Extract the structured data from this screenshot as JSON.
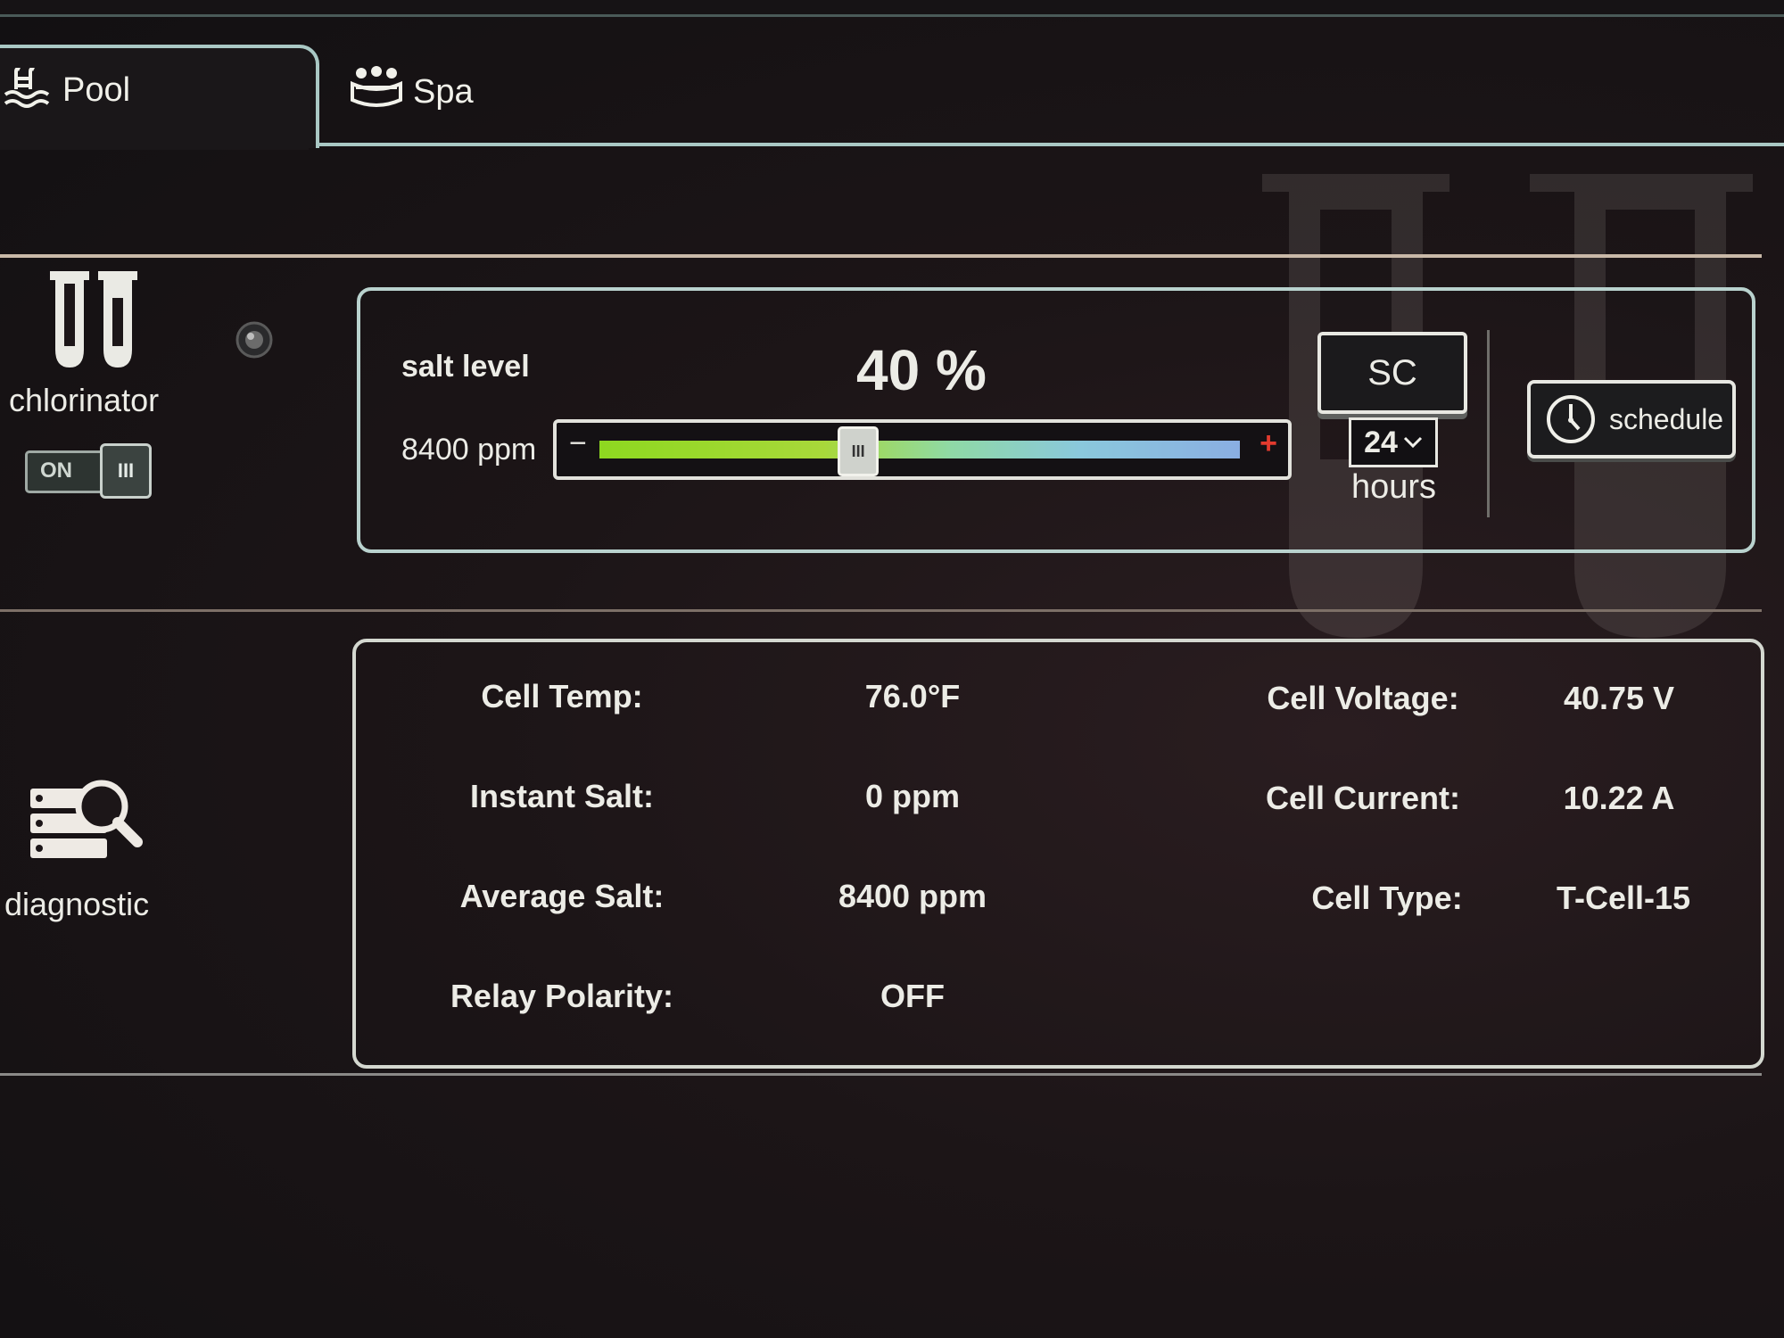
{
  "tabs": [
    {
      "label": "Pool",
      "icon": "swimming-pool-icon",
      "active": true
    },
    {
      "label": "Spa",
      "icon": "spa-hot-tub-icon",
      "active": false
    }
  ],
  "chlorinator": {
    "label": "chlorinator",
    "toggle_label": "ON",
    "toggle_knob": "III",
    "is_on": true
  },
  "salt": {
    "label": "salt level",
    "percent_text": "40 %",
    "percent": 40,
    "ppm_text": "8400 ppm",
    "minus": "−",
    "plus": "+",
    "thumb_grip": "III"
  },
  "super_chlorinate": {
    "button_label": "SC",
    "hours_value": "24",
    "hours_label": "hours"
  },
  "schedule": {
    "label": "schedule",
    "icon": "clock-icon"
  },
  "diagnostic": {
    "label": "diagnostic",
    "icon": "server-search-icon",
    "left": [
      {
        "label": "Cell Temp:",
        "value": "76.0°F"
      },
      {
        "label": "Instant Salt:",
        "value": "0 ppm"
      },
      {
        "label": "Average Salt:",
        "value": "8400 ppm"
      },
      {
        "label": "Relay Polarity:",
        "value": "OFF"
      }
    ],
    "right": [
      {
        "label": "Cell Voltage:",
        "value": "40.75 V"
      },
      {
        "label": "Cell Current:",
        "value": "10.22 A"
      },
      {
        "label": "Cell Type:",
        "value": "T-Cell-15"
      }
    ]
  },
  "colors": {
    "panel_border": "#b9d2ce",
    "slider_start": "#8ed820",
    "slider_end": "#8aaee2",
    "plus_red": "#e23a2e"
  }
}
